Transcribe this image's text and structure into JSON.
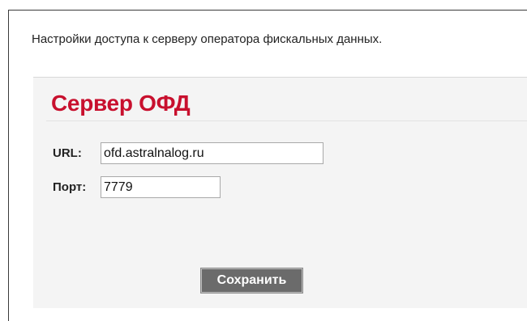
{
  "description": "Настройки доступа к серверу оператора фискальных данных.",
  "panel": {
    "title": "Сервер ОФД",
    "url": {
      "label": "URL:",
      "value": "ofd.astralnalog.ru"
    },
    "port": {
      "label": "Порт:",
      "value": "7779"
    },
    "save_label": "Сохранить"
  },
  "colors": {
    "title": "#c8102e",
    "panel_background": "#f4f4f4",
    "button_background": "#6b6b6b",
    "button_text": "#ffffff"
  }
}
